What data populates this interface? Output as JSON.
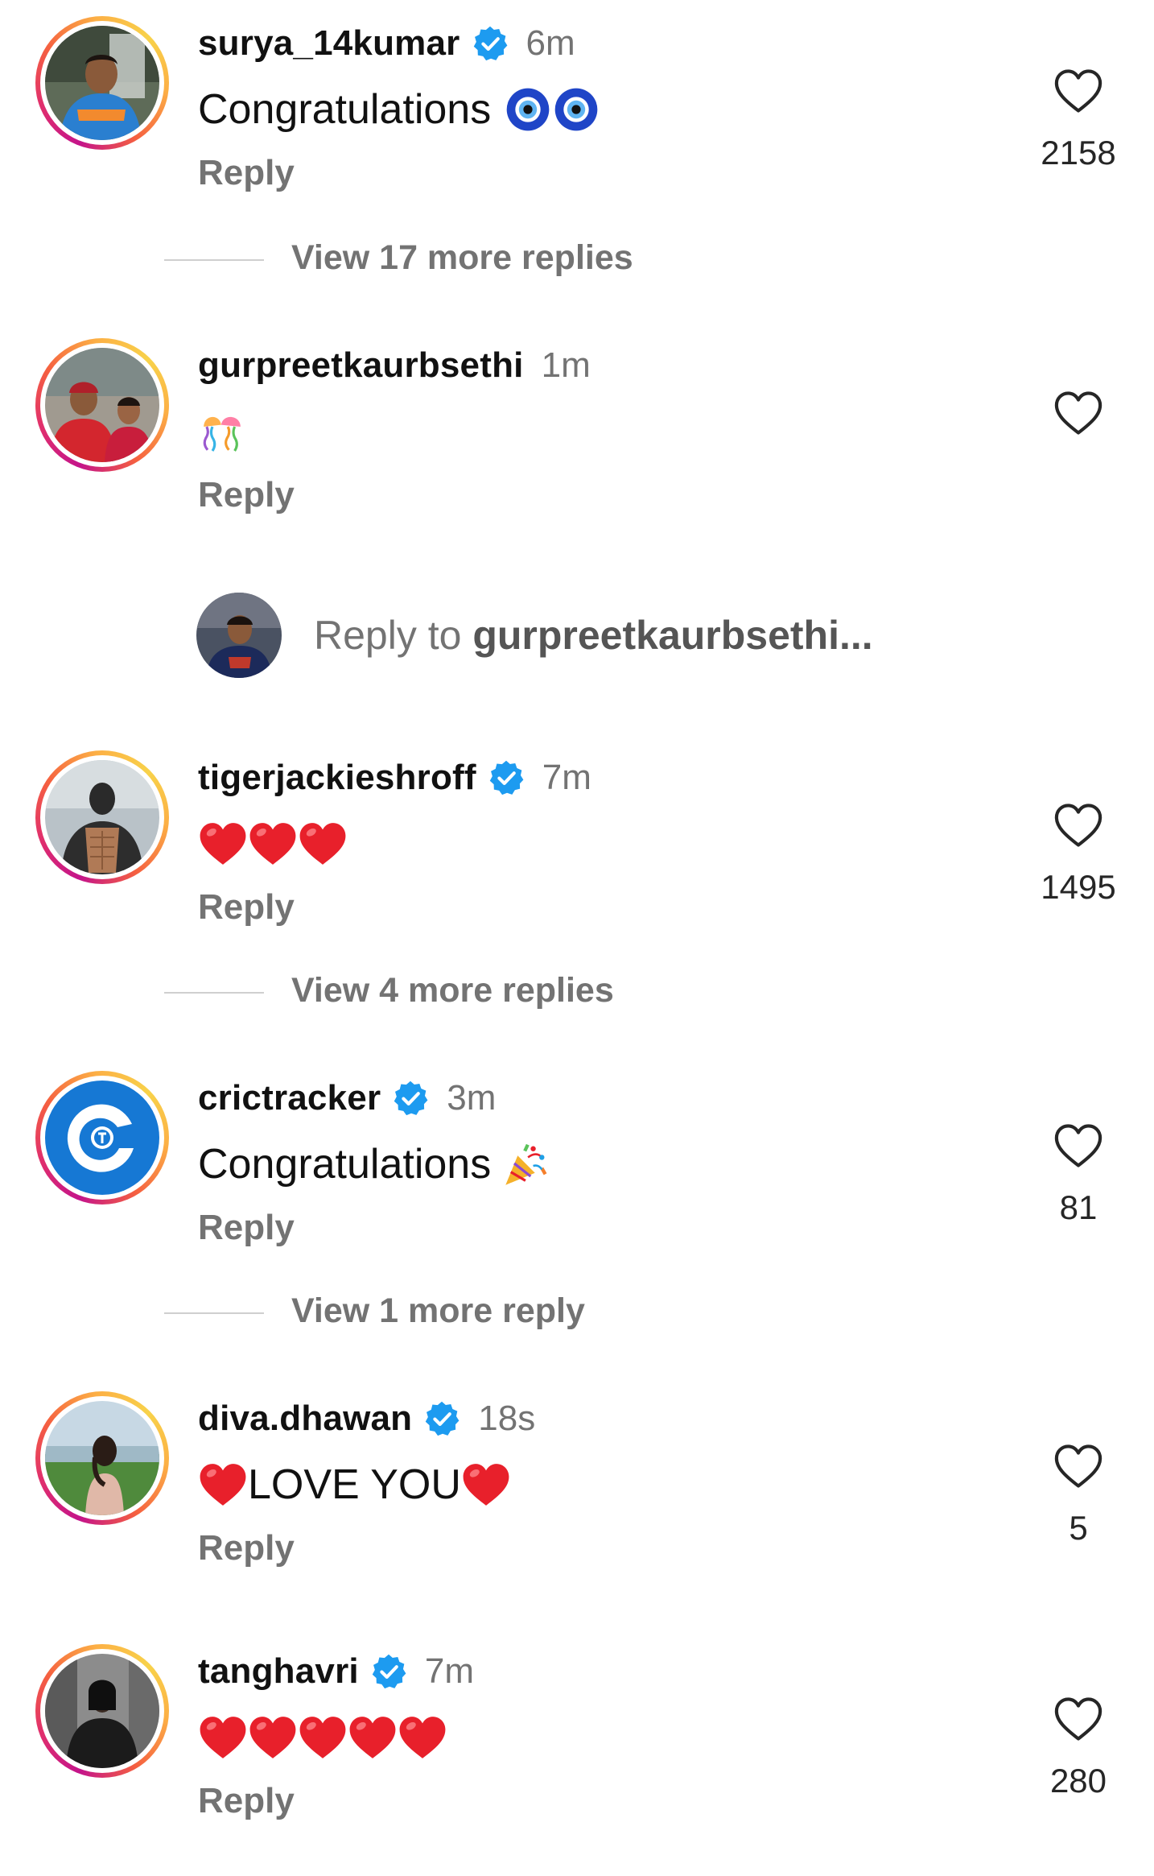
{
  "comments": [
    {
      "username": "surya_14kumar",
      "verified": true,
      "time": "6m",
      "text": "Congratulations",
      "emoji": [
        "nazar-amulet-icon",
        "nazar-amulet-icon"
      ],
      "reply_label": "Reply",
      "likes": "2158",
      "more_replies": "View 17 more replies"
    },
    {
      "username": "gurpreetkaurbsethi",
      "verified": false,
      "time": "1m",
      "text": "",
      "emoji": [
        "jellyfish-icon"
      ],
      "reply_label": "Reply",
      "likes": "",
      "more_replies": ""
    },
    {
      "username": "tigerjackieshroff",
      "verified": true,
      "time": "7m",
      "text": "",
      "emoji": [
        "red-heart-icon",
        "red-heart-icon",
        "red-heart-icon"
      ],
      "reply_label": "Reply",
      "likes": "1495",
      "more_replies": "View 4 more replies"
    },
    {
      "username": "crictracker",
      "verified": true,
      "time": "3m",
      "text": "Congratulations",
      "emoji": [
        "party-popper-icon"
      ],
      "reply_label": "Reply",
      "likes": "81",
      "more_replies": "View 1 more reply"
    },
    {
      "username": "diva.dhawan",
      "verified": true,
      "time": "18s",
      "text": "LOVE YOU",
      "emoji": [
        "red-heart-icon",
        "red-heart-icon"
      ],
      "reply_label": "Reply",
      "likes": "5",
      "more_replies": ""
    },
    {
      "username": "tanghavri",
      "verified": true,
      "time": "7m",
      "text": "",
      "emoji": [
        "red-heart-icon",
        "red-heart-icon",
        "red-heart-icon",
        "red-heart-icon",
        "red-heart-icon"
      ],
      "reply_label": "Reply",
      "likes": "280",
      "more_replies": ""
    }
  ],
  "reply_composer": {
    "prefix": "Reply to ",
    "target": "gurpreetkaurbsethi..."
  },
  "colors": {
    "verified_blue": "#1d9bf0",
    "heart_red": "#e8202b",
    "secondary_text": "#737373"
  }
}
